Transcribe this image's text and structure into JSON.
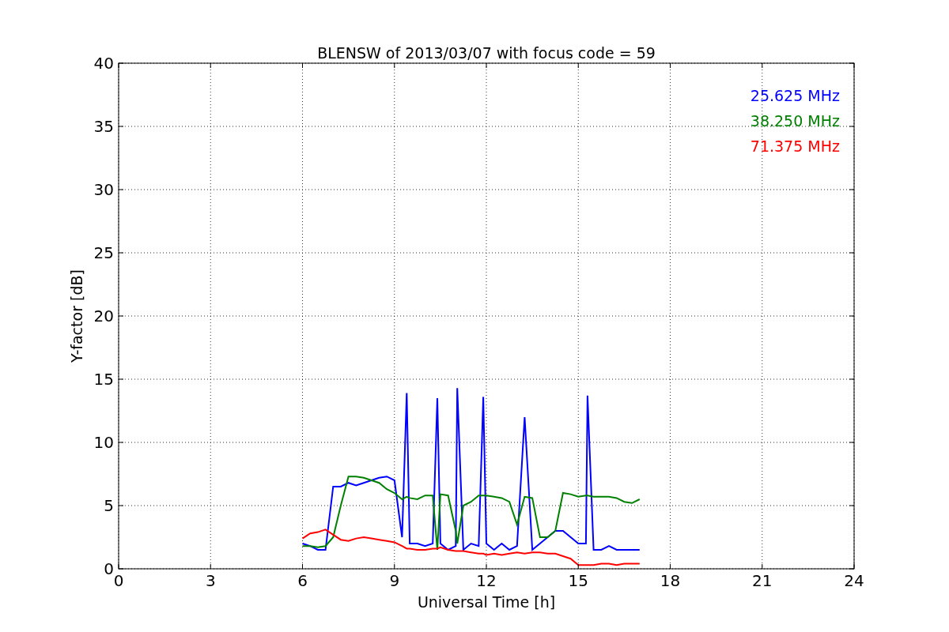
{
  "figure": {
    "chart_data": {
      "type": "line",
      "title": "BLENSW of 2013/03/07 with focus code = 59",
      "xlabel": "Universal Time [h]",
      "ylabel": "Y-factor [dB]",
      "x": [
        6,
        6.25,
        6.5,
        6.75,
        7,
        7.25,
        7.5,
        7.75,
        8,
        8.25,
        8.5,
        8.75,
        9,
        9.25,
        9.4,
        9.5,
        9.75,
        10,
        10.25,
        10.4,
        10.5,
        10.75,
        11,
        11.05,
        11.25,
        11.5,
        11.75,
        11.9,
        12,
        12.25,
        12.5,
        12.75,
        13,
        13.25,
        13.5,
        13.75,
        14,
        14.25,
        14.5,
        14.75,
        15,
        15.25,
        15.3,
        15.5,
        15.75,
        16,
        16.25,
        16.5,
        16.75,
        17
      ],
      "series": [
        {
          "name": "25.625 MHz",
          "color": "#0000ff",
          "values": [
            2,
            1.8,
            1.5,
            1.5,
            6.5,
            6.5,
            6.8,
            6.6,
            6.8,
            7,
            7.2,
            7.3,
            7,
            2.5,
            13.9,
            2,
            2,
            1.8,
            2,
            13.5,
            2,
            1.5,
            1.8,
            14.3,
            1.5,
            2,
            1.8,
            13.6,
            2,
            1.5,
            2,
            1.5,
            1.8,
            12,
            1.5,
            2,
            2.5,
            3,
            3,
            2.5,
            2,
            2,
            13.7,
            1.5,
            1.5,
            1.8,
            1.5,
            1.5,
            1.5,
            1.5
          ]
        },
        {
          "name": "38.250 MHz",
          "color": "#008000",
          "values": [
            1.8,
            1.8,
            1.7,
            1.8,
            2.5,
            5,
            7.3,
            7.3,
            7.2,
            7,
            6.8,
            6.3,
            6,
            5.5,
            5.7,
            5.6,
            5.5,
            5.8,
            5.8,
            1.5,
            5.9,
            5.8,
            3,
            2,
            5,
            5.3,
            5.8,
            5.8,
            5.8,
            5.7,
            5.6,
            5.3,
            3.5,
            5.7,
            5.6,
            2.5,
            2.5,
            3,
            6,
            5.9,
            5.7,
            5.8,
            5.8,
            5.7,
            5.7,
            5.7,
            5.6,
            5.3,
            5.2,
            5.5
          ]
        },
        {
          "name": "71.375 MHz",
          "color": "#ff0000",
          "values": [
            2.4,
            2.8,
            2.9,
            3.1,
            2.7,
            2.3,
            2.2,
            2.4,
            2.5,
            2.4,
            2.3,
            2.2,
            2.1,
            1.8,
            1.6,
            1.6,
            1.5,
            1.5,
            1.6,
            1.6,
            1.7,
            1.5,
            1.4,
            1.4,
            1.4,
            1.3,
            1.2,
            1.2,
            1.1,
            1.2,
            1.1,
            1.2,
            1.3,
            1.2,
            1.3,
            1.3,
            1.2,
            1.2,
            1,
            0.8,
            0.3,
            0.3,
            0.3,
            0.3,
            0.4,
            0.4,
            0.3,
            0.4,
            0.4,
            0.4
          ]
        }
      ],
      "grid": true,
      "xlim": [
        0,
        24
      ],
      "ylim": [
        0,
        40
      ],
      "xticks": [
        0,
        3,
        6,
        9,
        12,
        15,
        18,
        21,
        24
      ],
      "yticks": [
        0,
        5,
        10,
        15,
        20,
        25,
        30,
        35,
        40
      ]
    }
  }
}
